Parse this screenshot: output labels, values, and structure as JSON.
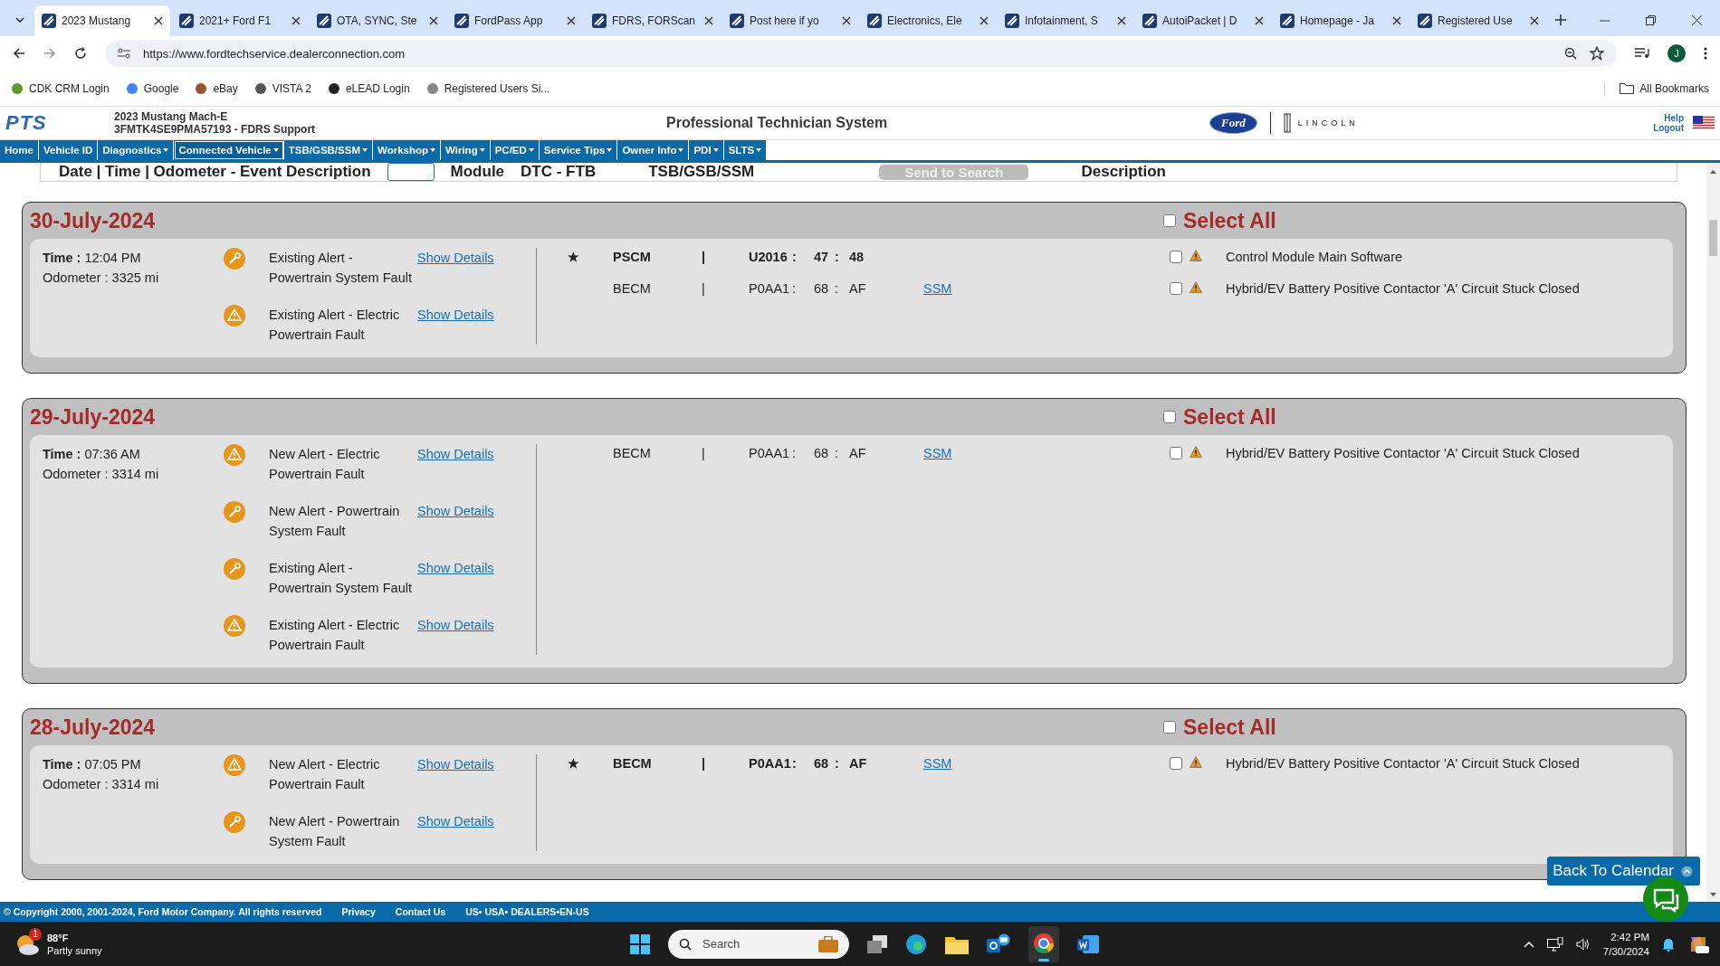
{
  "browser": {
    "tabs": [
      {
        "title": "2023 Mustang",
        "selected": true
      },
      {
        "title": "2021+ Ford F1",
        "selected": false
      },
      {
        "title": "OTA, SYNC, Ste",
        "selected": false
      },
      {
        "title": "FordPass App",
        "selected": false
      },
      {
        "title": "FDRS, FORScan",
        "selected": false
      },
      {
        "title": "Post here if yo",
        "selected": false
      },
      {
        "title": "Electronics, Ele",
        "selected": false
      },
      {
        "title": "Infotainment, S",
        "selected": false
      },
      {
        "title": "AutoiPacket | D",
        "selected": false
      },
      {
        "title": "Homepage - Ja",
        "selected": false
      },
      {
        "title": "Registered Use",
        "selected": false
      }
    ],
    "url": "https://www.fordtechservice.dealerconnection.com",
    "profile_initial": "J",
    "bookmarks": [
      "CDK CRM Login",
      "Google",
      "eBay",
      "VISTA 2",
      "eLEAD Login",
      "Registered Users Si..."
    ],
    "all_bookmarks": "All Bookmarks"
  },
  "site_header": {
    "logo": "PTS",
    "vehicle": "2023 Mustang Mach-E",
    "vin": "3FMTK4SE9PMA57193 - FDRS Support",
    "title": "Professional Technician System",
    "brand_1": "Ford",
    "brand_2": "LINCOLN",
    "help": "Help",
    "logout": "Logout"
  },
  "nav": [
    {
      "label": "Home",
      "dropdown": false,
      "selected": false
    },
    {
      "label": "Vehicle ID",
      "dropdown": false,
      "selected": false
    },
    {
      "label": "Diagnostics",
      "dropdown": true,
      "selected": false
    },
    {
      "label": "Connected Vehicle",
      "dropdown": true,
      "selected": true
    },
    {
      "label": "TSB/GSB/SSM",
      "dropdown": true,
      "selected": false
    },
    {
      "label": "Workshop",
      "dropdown": true,
      "selected": false
    },
    {
      "label": "Wiring",
      "dropdown": true,
      "selected": false
    },
    {
      "label": "PC/ED",
      "dropdown": true,
      "selected": false
    },
    {
      "label": "Service Tips",
      "dropdown": true,
      "selected": false
    },
    {
      "label": "Owner Info",
      "dropdown": true,
      "selected": false
    },
    {
      "label": "PDI",
      "dropdown": true,
      "selected": false
    },
    {
      "label": "SLTS",
      "dropdown": true,
      "selected": false
    }
  ],
  "column_headers": {
    "event": "Date | Time | Odometer - Event Description",
    "module": "Module",
    "dtc": "DTC - FTB",
    "tsb": "TSB/GSB/SSM",
    "send": "Send to Search",
    "description": "Description"
  },
  "cards": [
    {
      "date": "30-July-2024",
      "select_all_label": "Select All",
      "select_all": false,
      "time_label": "Time :",
      "time": "12:04 PM",
      "odometer_label": "Odometer :",
      "odometer": "3325 mi",
      "alerts": [
        {
          "kind": "wrench",
          "text": "Existing Alert - Powertrain System Fault",
          "link": "Show Details"
        },
        {
          "kind": "warning",
          "text": "Existing Alert - Electric Powertrain Fault",
          "link": "Show Details"
        }
      ],
      "dtcs": [
        {
          "star": "★",
          "bold": true,
          "module": "PSCM",
          "sep_1": "|",
          "dtc": "U2016",
          "sep_2": ":",
          "num": "47",
          "sep_3": ":",
          "ftb": "48",
          "checked": false,
          "description": "Control Module Main Software"
        },
        {
          "bold": false,
          "module": "BECM",
          "sep_1": "|",
          "dtc": "P0AA1",
          "sep_2": ":",
          "num": "68",
          "sep_3": ":",
          "ftb": "AF",
          "ssm": "SSM",
          "checked": false,
          "description": "Hybrid/EV Battery Positive Contactor 'A' Circuit Stuck Closed"
        }
      ]
    },
    {
      "date": "29-July-2024",
      "select_all_label": "Select All",
      "select_all": false,
      "time_label": "Time :",
      "time": "07:36 AM",
      "odometer_label": "Odometer :",
      "odometer": "3314 mi",
      "alerts": [
        {
          "kind": "warning",
          "text": "New Alert - Electric Powertrain Fault",
          "link": "Show Details"
        },
        {
          "kind": "wrench",
          "text": "New Alert - Powertrain System Fault",
          "link": "Show Details"
        },
        {
          "kind": "wrench",
          "text": "Existing Alert - Powertrain System Fault",
          "link": "Show Details"
        },
        {
          "kind": "warning",
          "text": "Existing Alert - Electric Powertrain Fault",
          "link": "Show Details"
        }
      ],
      "dtcs": [
        {
          "bold": false,
          "module": "BECM",
          "sep_1": "|",
          "dtc": "P0AA1",
          "sep_2": ":",
          "num": "68",
          "sep_3": ":",
          "ftb": "AF",
          "ssm": "SSM",
          "checked": false,
          "description": "Hybrid/EV Battery Positive Contactor 'A' Circuit Stuck Closed"
        }
      ]
    },
    {
      "date": "28-July-2024",
      "select_all_label": "Select All",
      "select_all": false,
      "time_label": "Time :",
      "time": "07:05 PM",
      "odometer_label": "Odometer :",
      "odometer": "3314 mi",
      "alerts": [
        {
          "kind": "warning",
          "text": "New Alert - Electric Powertrain Fault",
          "link": "Show Details"
        },
        {
          "kind": "wrench",
          "text": "New Alert - Powertrain System Fault",
          "link": "Show Details"
        }
      ],
      "dtcs": [
        {
          "star": "★",
          "bold": true,
          "module": "BECM",
          "sep_1": "|",
          "dtc": "P0AA1",
          "sep_2": ":",
          "num": "68",
          "sep_3": ":",
          "ftb": "AF",
          "ssm": "SSM",
          "checked": false,
          "description": "Hybrid/EV Battery Positive Contactor 'A' Circuit Stuck Closed"
        }
      ]
    }
  ],
  "back_button": "Back To Calendar",
  "footer": {
    "copyright": "© Copyright 2000, 2001-2024, Ford Motor Company. All rights reserved",
    "privacy": "Privacy",
    "contact": "Contact Us",
    "locale": "US• USA• DEALERS•EN-US"
  },
  "taskbar": {
    "temperature": "88°F",
    "weather": "Partly sunny",
    "weather_badge": "1",
    "search_placeholder": "Search",
    "time": "2:42 PM",
    "date": "7/30/2024"
  }
}
